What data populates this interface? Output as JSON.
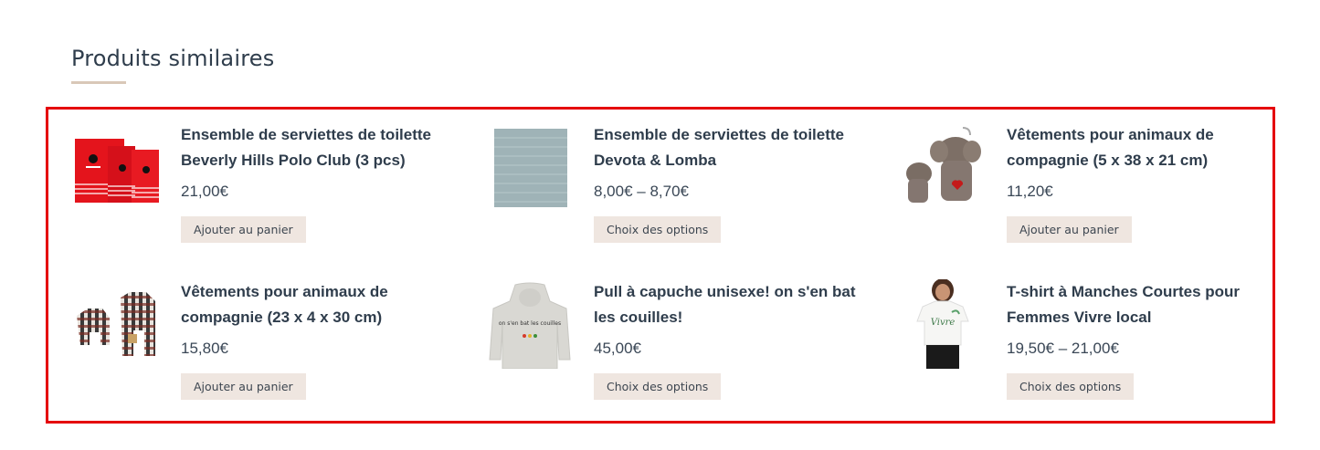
{
  "section": {
    "title": "Produits similaires"
  },
  "products": [
    {
      "title": "Ensemble de serviettes de toilette Beverly Hills Polo Club (3 pcs)",
      "price": "21,00€",
      "button": "Ajouter au panier"
    },
    {
      "title": "Ensemble de serviettes de toilette Devota & Lomba",
      "price": "8,00€ – 8,70€",
      "button": "Choix des options"
    },
    {
      "title": "Vêtements pour animaux de compagnie (5 x 38 x 21 cm)",
      "price": "11,20€",
      "button": "Ajouter au panier"
    },
    {
      "title": "Vêtements pour animaux de compagnie (23 x 4 x 30 cm)",
      "price": "15,80€",
      "button": "Ajouter au panier"
    },
    {
      "title": "Pull à capuche unisexe! on s'en bat les couilles!",
      "price": "45,00€",
      "button": "Choix des options",
      "image_text": "on s'en bat les couilles"
    },
    {
      "title": "T-shirt à Manches Courtes pour Femmes Vivre local",
      "price": "19,50€ – 21,00€",
      "button": "Choix des options",
      "image_text": "Vivre"
    }
  ],
  "colors": {
    "highlight": "#e5000b",
    "button_bg": "#efe6e0",
    "title_underline": "#d9c8b8",
    "text": "#2f3d4c"
  }
}
